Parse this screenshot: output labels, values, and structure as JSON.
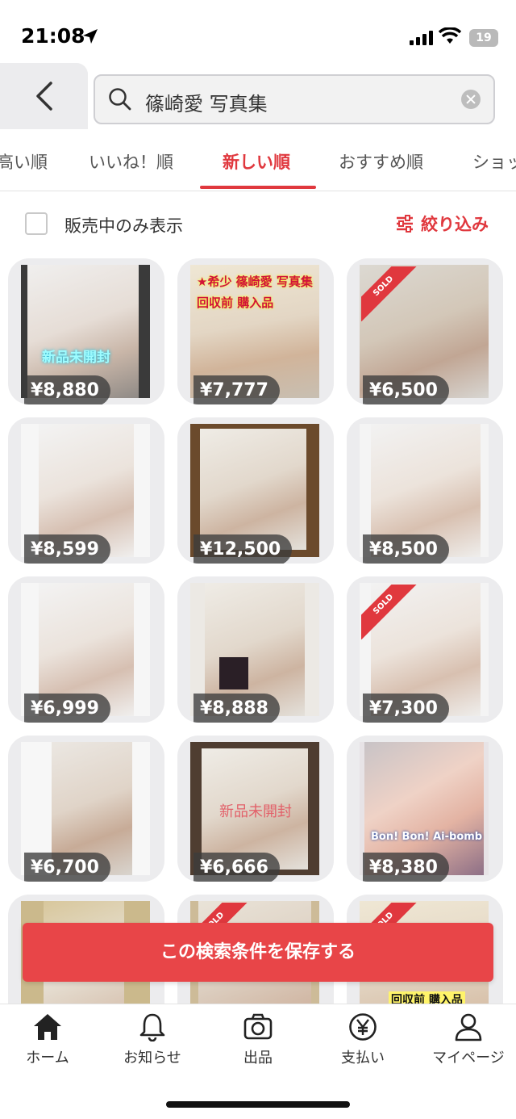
{
  "status_bar": {
    "time": "21:08",
    "battery": "19"
  },
  "search": {
    "query": "篠崎愛 写真集"
  },
  "tabs": [
    {
      "label": "高い順"
    },
    {
      "label": "いいね！順"
    },
    {
      "label": "新しい順",
      "active": true
    },
    {
      "label": "おすすめ順"
    },
    {
      "label": "ショッ"
    }
  ],
  "filter": {
    "on_sale_only_label": "販売中のみ表示",
    "on_sale_only_checked": false,
    "refine_label": "絞り込み"
  },
  "items": [
    {
      "price": "¥8,880",
      "sold": false,
      "overlay": "新品未開封"
    },
    {
      "price": "¥7,777",
      "sold": false,
      "overlay": "★希少 篠崎愛 写真集 回収前 購入品"
    },
    {
      "price": "¥6,500",
      "sold": true,
      "overlay": ""
    },
    {
      "price": "¥8,599",
      "sold": false,
      "overlay": ""
    },
    {
      "price": "¥12,500",
      "sold": false,
      "overlay": ""
    },
    {
      "price": "¥8,500",
      "sold": false,
      "overlay": ""
    },
    {
      "price": "¥6,999",
      "sold": false,
      "overlay": ""
    },
    {
      "price": "¥8,888",
      "sold": false,
      "overlay": ""
    },
    {
      "price": "¥7,300",
      "sold": true,
      "overlay": ""
    },
    {
      "price": "¥6,700",
      "sold": false,
      "overlay": ""
    },
    {
      "price": "¥6,666",
      "sold": false,
      "overlay": "新品未開封"
    },
    {
      "price": "¥8,380",
      "sold": false,
      "overlay": "Bon! Bon! Ai-bomb"
    }
  ],
  "partial_row": {
    "sold_label": "SOLD",
    "overlay": "回収前 購入品"
  },
  "save_search_label": "この検索条件を保存する",
  "nav": {
    "home": "ホーム",
    "notifications": "お知らせ",
    "sell": "出品",
    "payment": "支払い",
    "mypage": "マイページ"
  },
  "colors": {
    "accent": "#e0383e",
    "save_button": "#e84548",
    "card_bg": "#ececee"
  }
}
